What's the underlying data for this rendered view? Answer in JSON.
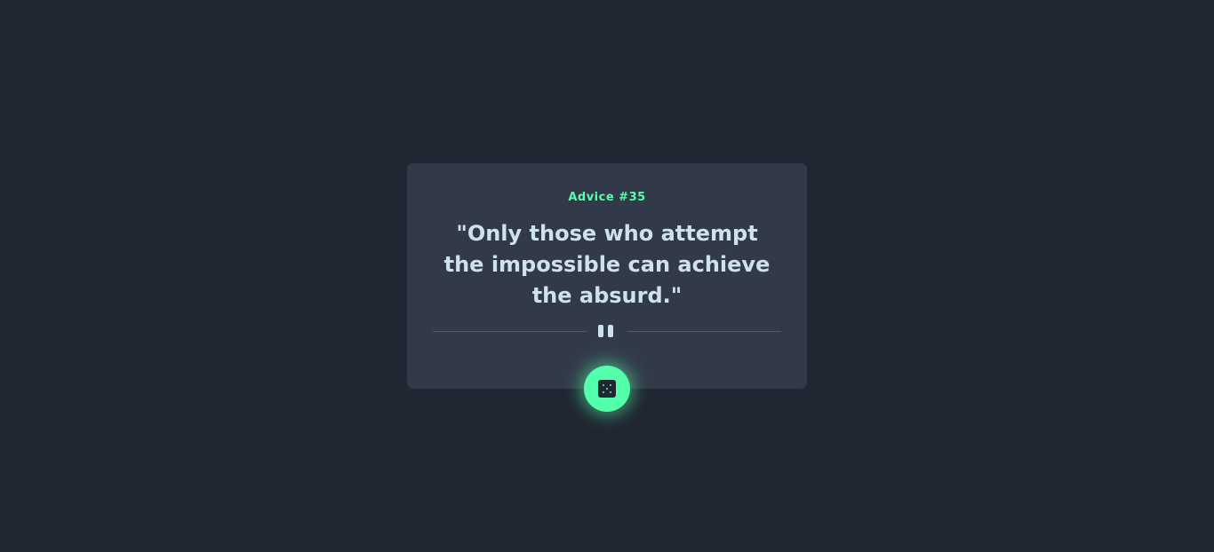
{
  "card": {
    "advice_label": "Advice #35",
    "quote": "\"Only those who attempt the impossible can achieve the absurd.\""
  },
  "divider": {
    "icon": "pause-icon"
  },
  "button": {
    "icon": "dice-icon",
    "accent_color": "#53ffaa"
  },
  "colors": {
    "background": "#202632",
    "card": "#323a49",
    "quote_text": "#cee3e9",
    "accent": "#53ffaa"
  }
}
